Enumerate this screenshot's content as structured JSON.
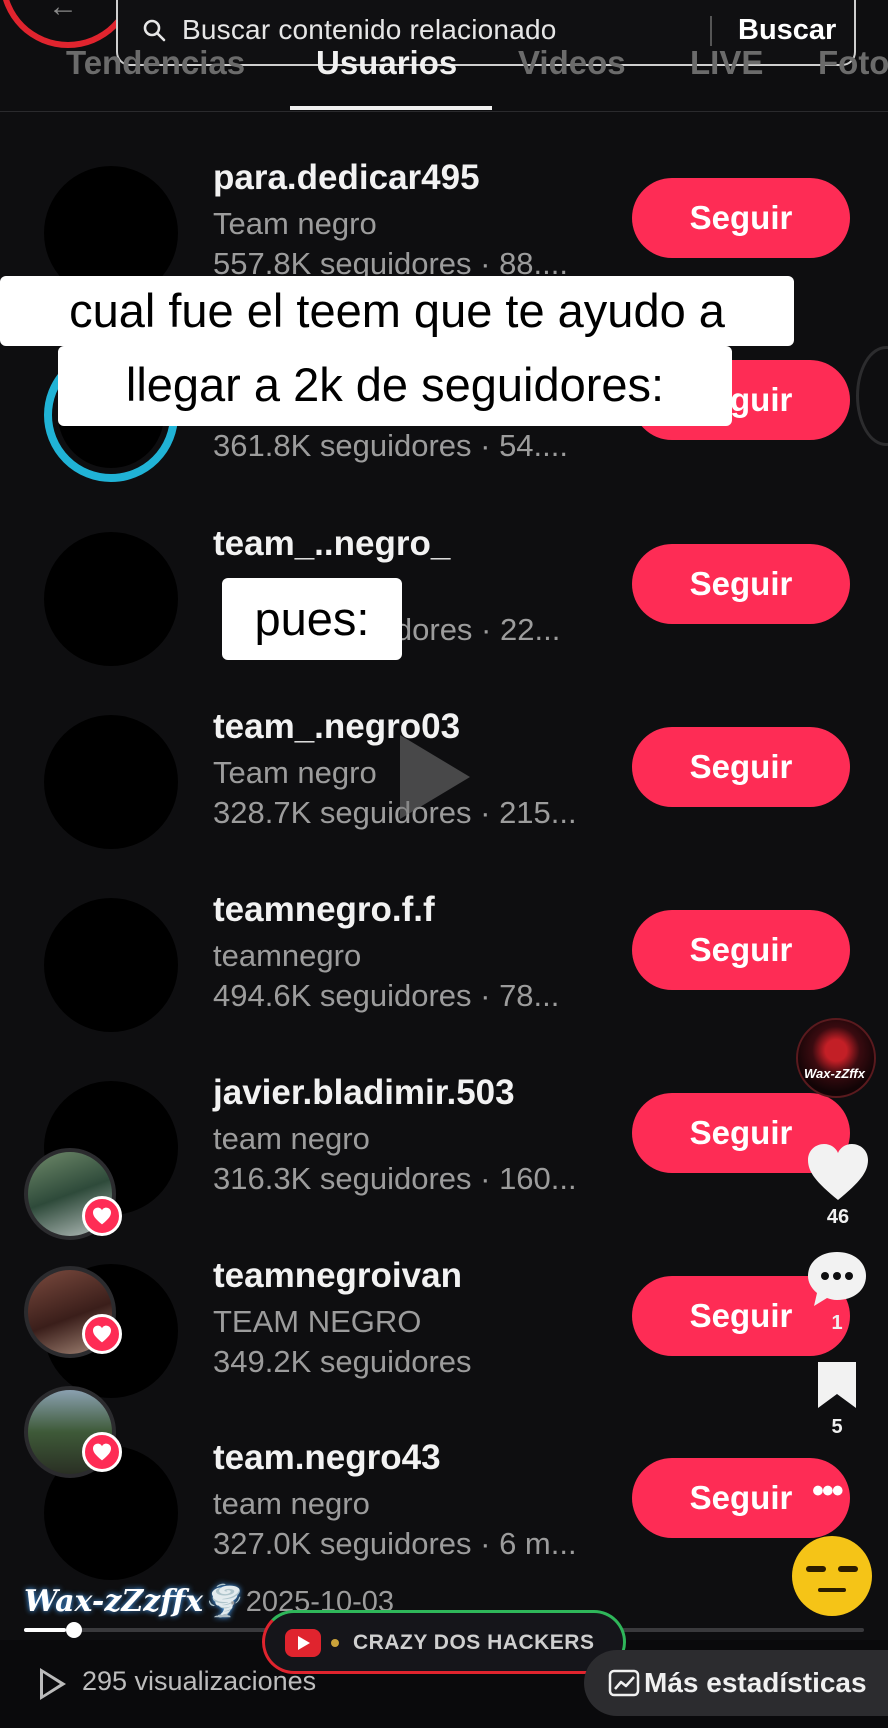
{
  "search": {
    "query": "Buscar contenido relacionado",
    "button_label": "Buscar"
  },
  "tabs": [
    {
      "label": "Tendencias",
      "active": false
    },
    {
      "label": "Usuarios",
      "active": true
    },
    {
      "label": "Videos",
      "active": false
    },
    {
      "label": "LIVE",
      "active": false
    },
    {
      "label": "Fotos",
      "active": false
    }
  ],
  "users": [
    {
      "username": "para.dedicar495",
      "nickname": "Team negro",
      "stats": "557.8K seguidores · 88....",
      "follow_label": "Seguir"
    },
    {
      "username": "",
      "nickname": "",
      "stats": "361.8K seguidores · 54....",
      "follow_label": "Seguir",
      "live": true
    },
    {
      "username": "team_..negro_",
      "nickname": "",
      "stats": "idores · 22...",
      "follow_label": "Seguir"
    },
    {
      "username": "team_.negro03",
      "nickname": "Team negro",
      "stats": "328.7K seguidores · 215...",
      "follow_label": "Seguir"
    },
    {
      "username": "teamnegro.f.f",
      "nickname": "teamnegro",
      "stats": "494.6K seguidores · 78...",
      "follow_label": "Seguir"
    },
    {
      "username": "javier.bladimir.503",
      "nickname": "team negro",
      "stats": "316.3K seguidores · 160...",
      "follow_label": "Seguir"
    },
    {
      "username": "teamnegroivan",
      "nickname": "TEAM NEGRO",
      "stats": "349.2K seguidores",
      "follow_label": "Seguir"
    },
    {
      "username": "team.negro43",
      "nickname": "team negro",
      "stats": "327.0K seguidores · 6 m...",
      "follow_label": "Seguir"
    }
  ],
  "captions": {
    "line1": "cual fue el teem que te ayudo a",
    "line2": "llegar a 2k de seguidores:",
    "line3": "pues:"
  },
  "creator": {
    "tag": "Wax-zZffx"
  },
  "actions": {
    "likes": "46",
    "comments": "1",
    "saves": "5"
  },
  "video": {
    "author": "Wax-zZzffx🌪️",
    "date": "· 2025-10-03",
    "progress": 0.05
  },
  "promo": {
    "label": "CRAZY DOS HACKERS"
  },
  "footer": {
    "views": "295 visualizaciones",
    "stats_button": "Más estadísticas"
  },
  "colors": {
    "follow": "#fe2c55",
    "live_ring": "#20b3d6",
    "background": "#0e0e10"
  }
}
